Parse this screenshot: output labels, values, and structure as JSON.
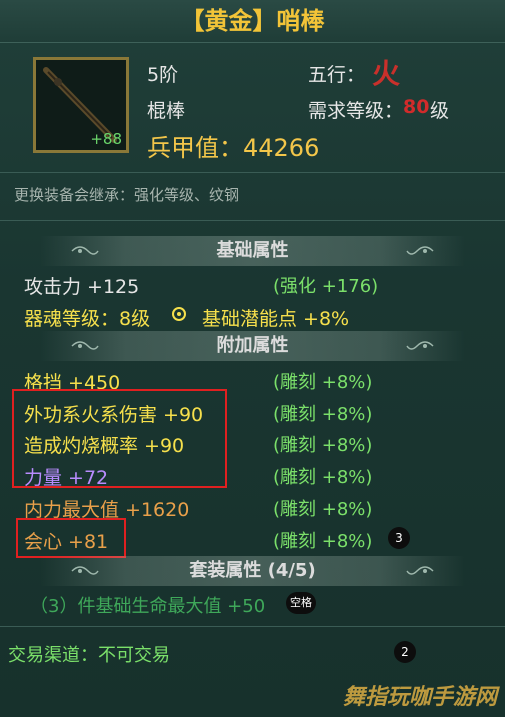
{
  "item": {
    "title": "【黄金】哨棒",
    "tier": "5阶",
    "type": "棍棒",
    "element_label": "五行：",
    "element_glyph": "火",
    "req_label": "需求等级：",
    "req_level": "80",
    "req_suffix": "级",
    "power_text": "兵甲值：44266",
    "icon_bonus": "+88",
    "icon_name": "staff-icon"
  },
  "inherit_note": "更换装备会继承：强化等级、纹钢",
  "sections": {
    "basic": "基础属性",
    "extra": "附加属性",
    "set": "套装属性 (4/5)"
  },
  "basic_attrs": [
    {
      "name": "攻击力 +125",
      "bonus": "(强化 +176)"
    },
    {
      "name": "器魂等级：8级",
      "bonus": "基础潜能点 +8%"
    }
  ],
  "extra_attrs": [
    {
      "name": "格挡 +450",
      "bonus": "(雕刻 +8%)"
    },
    {
      "name": "外功系火系伤害 +90",
      "bonus": "(雕刻 +8%)"
    },
    {
      "name": "造成灼烧概率 +90",
      "bonus": "(雕刻 +8%)"
    },
    {
      "name": "力量 +72",
      "bonus": "(雕刻 +8%)"
    },
    {
      "name": "内力最大值 +1620",
      "bonus": "(雕刻 +8%)"
    },
    {
      "name": "会心 +81",
      "bonus": "(雕刻 +8%)"
    }
  ],
  "set_bonus": "（3）件基础生命最大值 +50",
  "trade": "交易渠道：不可交易",
  "badges": {
    "crit": "3",
    "set": "空格",
    "trade": "2"
  },
  "watermark": "舞指玩咖手游网",
  "colors": {
    "title": "#f2c438",
    "highlight_border": "#e02020",
    "set_text": "#3fa85a"
  }
}
